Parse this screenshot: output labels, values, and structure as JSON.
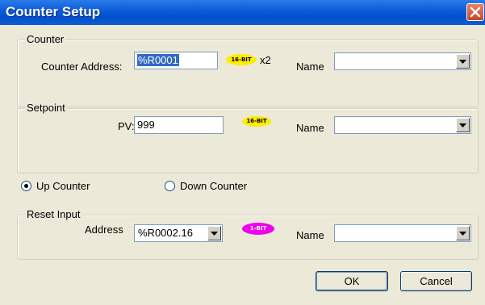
{
  "window": {
    "title": "Counter Setup"
  },
  "counter_group": {
    "legend": "Counter",
    "address_label": "Counter Address:",
    "address_value": "%R0001",
    "bit_badge": "16-BIT",
    "multiplier": "x2",
    "name_label": "Name",
    "name_value": ""
  },
  "setpoint_group": {
    "legend": "Setpoint",
    "pv_label": "PV:",
    "pv_value": "999",
    "bit_badge": "16-BIT",
    "name_label": "Name",
    "name_value": ""
  },
  "direction": {
    "up_label": "Up Counter",
    "down_label": "Down Counter",
    "selected": "up"
  },
  "reset_group": {
    "legend": "Reset Input",
    "address_label": "Address",
    "address_value": "%R0002.16",
    "bit_badge": "1-BIT",
    "name_label": "Name",
    "name_value": ""
  },
  "buttons": {
    "ok": "OK",
    "cancel": "Cancel"
  },
  "colors": {
    "title_bar": "#0a5ad8",
    "dialog_bg": "#ece9d8",
    "selection": "#316ac5",
    "badge_16bit": "#ffec00",
    "badge_1bit": "#ee00ee",
    "close_button": "#c8452a"
  },
  "icons": {
    "close": "close-icon",
    "dropdown": "chevron-down-icon"
  }
}
